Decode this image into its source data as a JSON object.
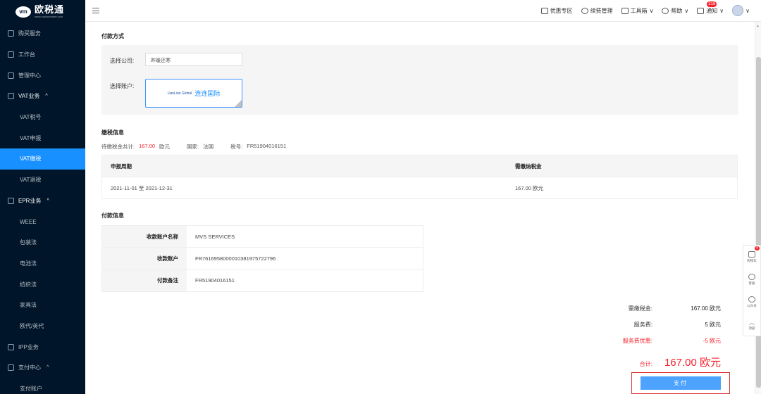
{
  "logo": {
    "title": "欧税通",
    "subtitle": "www.ourtaxcenter.com"
  },
  "sidebar": {
    "items": [
      {
        "label": "购买服务",
        "icon": "shopping-bag-icon"
      },
      {
        "label": "工作台",
        "icon": "clipboard-icon"
      },
      {
        "label": "管理中心",
        "icon": "monitor-icon"
      },
      {
        "label": "VAT业务",
        "icon": "briefcase-icon",
        "chevron": "^"
      },
      {
        "label": "VAT税号"
      },
      {
        "label": "VAT申报"
      },
      {
        "label": "VAT缴税"
      },
      {
        "label": "VAT退税"
      },
      {
        "label": "EPR业务",
        "icon": "recycle-icon",
        "chevron": "^"
      },
      {
        "label": "WEEE"
      },
      {
        "label": "包装法"
      },
      {
        "label": "电池法"
      },
      {
        "label": "纺织法"
      },
      {
        "label": "家具法"
      },
      {
        "label": "欧代/英代"
      },
      {
        "label": "IPP业务",
        "icon": "shield-icon"
      },
      {
        "label": "支付中心",
        "icon": "wallet-icon",
        "chevron": "^"
      },
      {
        "label": "支付账户"
      }
    ]
  },
  "header": {
    "items": [
      {
        "label": "优惠专区",
        "icon": "ticket-icon"
      },
      {
        "label": "续费管理",
        "icon": "renew-icon"
      },
      {
        "label": "工具箱",
        "icon": "toolbox-icon",
        "chevron": "∨"
      },
      {
        "label": "帮助",
        "icon": "help-icon",
        "chevron": "∨"
      },
      {
        "label": "通知",
        "icon": "bell-icon",
        "chevron": "∨",
        "badge": "318"
      }
    ],
    "avatar_chevron": "∨"
  },
  "payment_method": {
    "title": "付款方式",
    "company_label": "选择公司:",
    "company_value": "昨暖还寒",
    "account_label": "选择账户:",
    "account_brand": "LianLian Global",
    "account_name": "连连国际"
  },
  "tax_info": {
    "title": "缴税信息",
    "pending_label": "待缴税金共计:",
    "pending_amount": "167.00",
    "pending_unit": "欧元",
    "country_label": "国家:",
    "country_value": "法国",
    "taxno_label": "税号:",
    "taxno_value": "FR51904016151",
    "columns": [
      "申报周期",
      "需缴纳税金"
    ],
    "rows": [
      [
        "2021-11-01 至 2021-12-31",
        "167.00 欧元"
      ]
    ]
  },
  "payee_info": {
    "title": "付款信息",
    "rows": [
      {
        "label": "收款账户名称",
        "value": "MVS SERVICES"
      },
      {
        "label": "收款账户",
        "value": "FR7616958000010381975722796"
      },
      {
        "label": "付款备注",
        "value": "FR51904016151"
      }
    ]
  },
  "summary": {
    "tax_label": "需缴税金:",
    "tax_value": "167.00 欧元",
    "fee_label": "服务费:",
    "fee_value": "5 欧元",
    "discount_label": "服务费优惠:",
    "discount_value": "-5 欧元",
    "total_label": "合计:",
    "total_value": "167.00 欧元",
    "pay_button": "支付"
  },
  "float_bar": [
    {
      "label": "购物车",
      "icon": "cart-icon",
      "badge": "4"
    },
    {
      "label": "客服",
      "icon": "headset-icon"
    },
    {
      "label": "公众号",
      "icon": "wechat-icon"
    },
    {
      "label": "顶部",
      "icon": "arrow-up-icon"
    }
  ],
  "colors": {
    "sidebar_bg": "#001529",
    "accent": "#1890ff",
    "danger": "#f5222d"
  }
}
